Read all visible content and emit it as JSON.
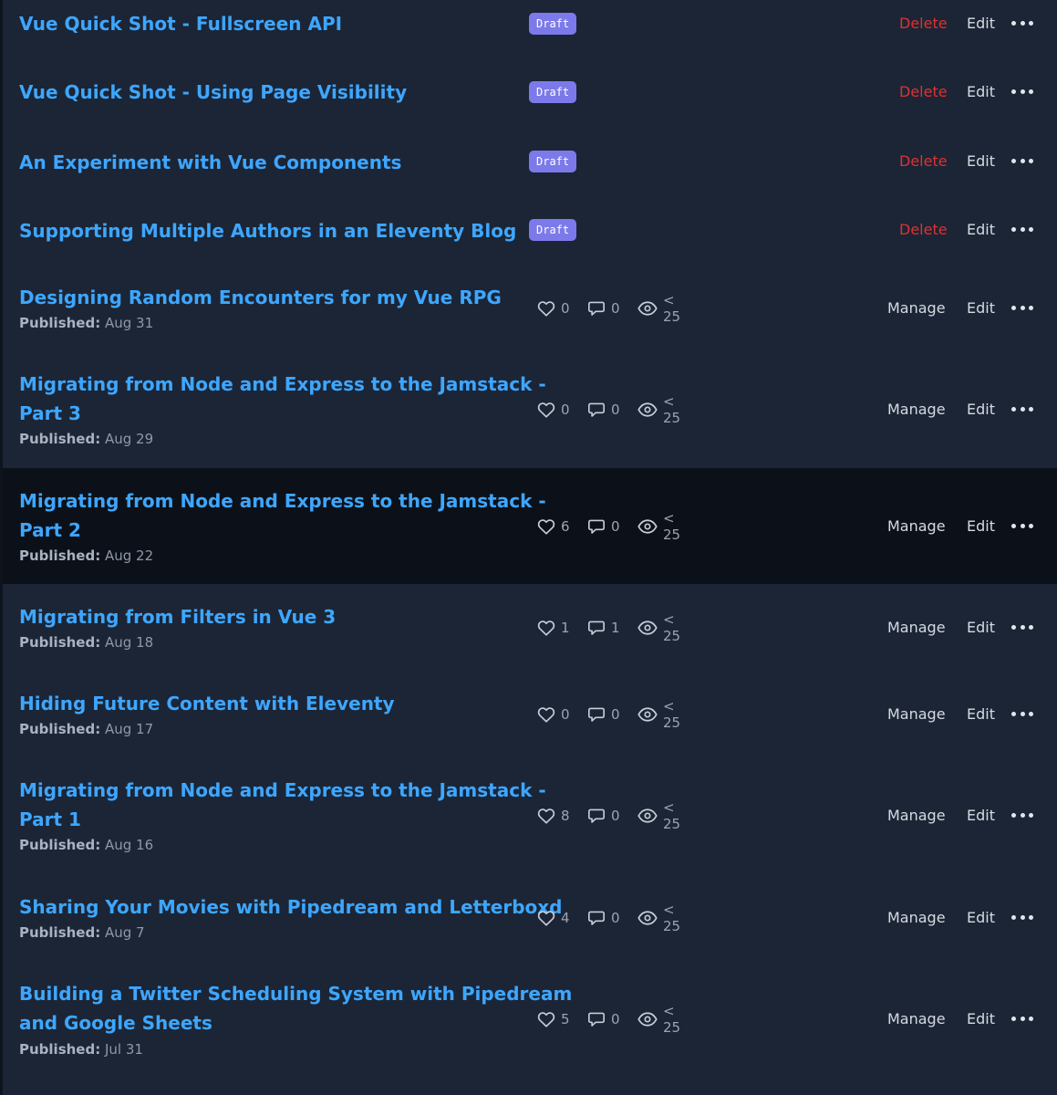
{
  "labels": {
    "draft": "Draft",
    "delete": "Delete",
    "edit": "Edit",
    "manage": "Manage",
    "published": "Published:"
  },
  "posts": [
    {
      "title_lines": [
        "Vue Quick Shot - Fullscreen API"
      ],
      "status": "draft"
    },
    {
      "title_lines": [
        "Vue Quick Shot - Using Page Visibility"
      ],
      "status": "draft"
    },
    {
      "title_lines": [
        "An Experiment with Vue Components"
      ],
      "status": "draft"
    },
    {
      "title_lines": [
        "Supporting Multiple Authors in an Eleventy Blog"
      ],
      "status": "draft"
    },
    {
      "title_lines": [
        "Designing Random Encounters for my Vue RPG"
      ],
      "status": "published",
      "date": "Aug 31",
      "likes": "0",
      "comments": "0",
      "views": "< 25"
    },
    {
      "title_lines": [
        "Migrating from Node and Express to the Jamstack -",
        "Part 3"
      ],
      "status": "published",
      "date": "Aug 29",
      "likes": "0",
      "comments": "0",
      "views": "< 25"
    },
    {
      "title_lines": [
        "Migrating from Node and Express to the Jamstack -",
        "Part 2"
      ],
      "status": "published",
      "date": "Aug 22",
      "likes": "6",
      "comments": "0",
      "views": "< 25",
      "highlighted": true
    },
    {
      "title_lines": [
        "Migrating from Filters in Vue 3"
      ],
      "status": "published",
      "date": "Aug 18",
      "likes": "1",
      "comments": "1",
      "views": "< 25"
    },
    {
      "title_lines": [
        "Hiding Future Content with Eleventy"
      ],
      "status": "published",
      "date": "Aug 17",
      "likes": "0",
      "comments": "0",
      "views": "< 25"
    },
    {
      "title_lines": [
        "Migrating from Node and Express to the Jamstack -",
        "Part 1"
      ],
      "status": "published",
      "date": "Aug 16",
      "likes": "8",
      "comments": "0",
      "views": "< 25"
    },
    {
      "title_lines": [
        "Sharing Your Movies with Pipedream and Letterboxd"
      ],
      "status": "published",
      "date": "Aug 7",
      "likes": "4",
      "comments": "0",
      "views": "< 25"
    },
    {
      "title_lines": [
        "Building a Twitter Scheduling System with Pipedream",
        "and Google Sheets"
      ],
      "status": "published",
      "date": "Jul 31",
      "likes": "5",
      "comments": "0",
      "views": "< 25"
    }
  ],
  "icons": {
    "likes": "heart-icon",
    "comments": "comment-icon",
    "views": "eye-icon",
    "more": "more-options-icon"
  },
  "colors": {
    "background": "#1b2535",
    "highlight_row": "#0c1119",
    "title": "#3ea6ff",
    "draft_badge": "#7c7aea",
    "delete": "#e03131"
  }
}
